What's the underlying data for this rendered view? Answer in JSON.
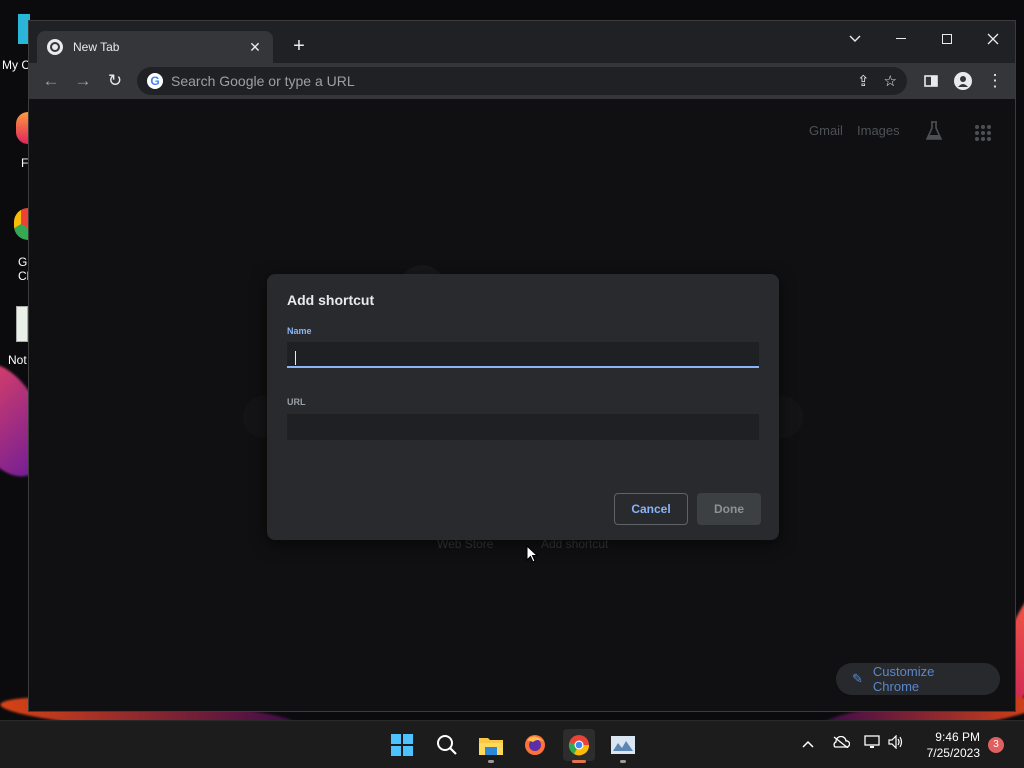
{
  "desktop": {
    "icons": [
      {
        "label": "My C"
      },
      {
        "label": "F"
      },
      {
        "label": "G\nCh"
      },
      {
        "label": "Not"
      }
    ]
  },
  "browser": {
    "tab": {
      "title": "New Tab"
    },
    "omnibox": {
      "placeholder": "Search Google or type a URL"
    },
    "links": {
      "gmail": "Gmail",
      "images": "Images"
    },
    "background_shortcuts": {
      "web_store": "Web Store",
      "add_shortcut": "Add shortcut"
    },
    "customize_label": "Customize Chrome"
  },
  "dialog": {
    "title": "Add shortcut",
    "name_label": "Name",
    "url_label": "URL",
    "name_value": "",
    "url_value": "",
    "cancel_label": "Cancel",
    "done_label": "Done"
  },
  "taskbar": {
    "time": "9:46 PM",
    "date": "7/25/2023",
    "notification_count": "3"
  },
  "colors": {
    "accent": "#8ab4f8",
    "dialog_bg": "#292a2d",
    "page_bg": "#202124"
  }
}
